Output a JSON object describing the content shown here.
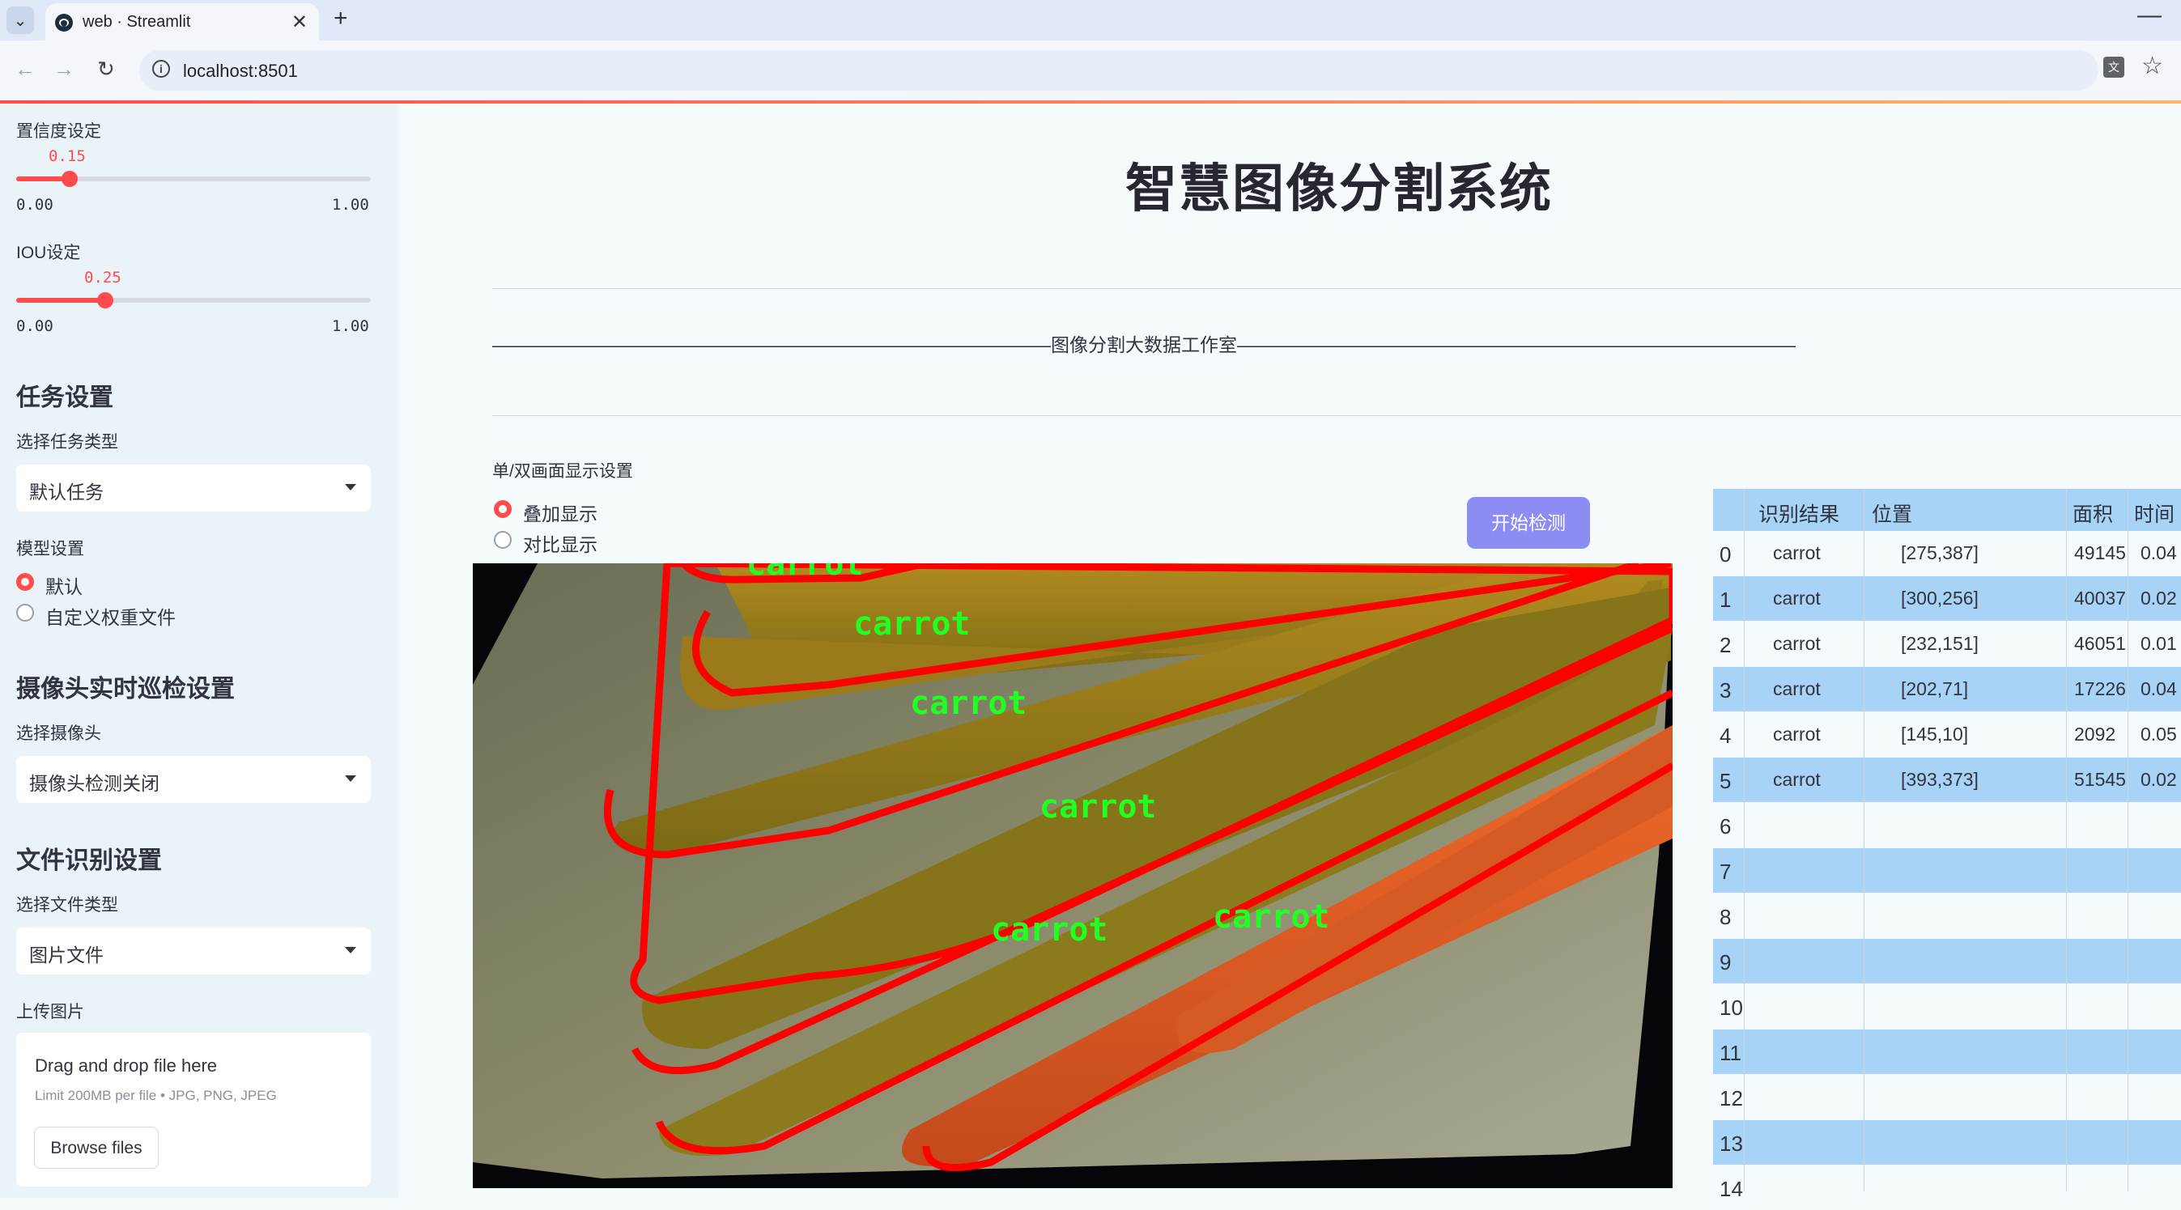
{
  "browser": {
    "tab_title": "web · Streamlit",
    "url": "localhost:8501"
  },
  "sidebar": {
    "confidence": {
      "label": "置信度设定",
      "value": "0.15",
      "value_fraction": 0.15,
      "min": "0.00",
      "max": "1.00"
    },
    "iou": {
      "label": "IOU设定",
      "value": "0.25",
      "value_fraction": 0.25,
      "min": "0.00",
      "max": "1.00"
    },
    "task_heading": "任务设置",
    "task_type_label": "选择任务类型",
    "task_type_value": "默认任务",
    "model_label": "模型设置",
    "model_options": [
      "默认",
      "自定义权重文件"
    ],
    "model_selected": 0,
    "camera_heading": "摄像头实时巡检设置",
    "camera_label": "选择摄像头",
    "camera_value": "摄像头检测关闭",
    "file_heading": "文件识别设置",
    "file_type_label": "选择文件类型",
    "file_type_value": "图片文件",
    "upload_label": "上传图片",
    "upload_drag": "Drag and drop file here",
    "upload_limit": "Limit 200MB per file • JPG, PNG, JPEG",
    "upload_button": "Browse files"
  },
  "main": {
    "title": "智慧图像分割系统",
    "divider_text": "——————————————————————————————图像分割大数据工作室——————————————————————————————",
    "display_label": "单/双画面显示设置",
    "display_options": [
      "叠加显示",
      "对比显示"
    ],
    "display_selected": 0,
    "start_button": "开始检测",
    "detection_labels": [
      "carrot",
      "carrot",
      "carrot",
      "carrot",
      "carrot",
      "carrot"
    ]
  },
  "table": {
    "headers": [
      "识别结果",
      "位置",
      "面积",
      "时间"
    ],
    "rows": [
      {
        "index": "0",
        "label": "carrot",
        "pos": "[275,387]",
        "area": "49145",
        "time": "0.04"
      },
      {
        "index": "1",
        "label": "carrot",
        "pos": "[300,256]",
        "area": "40037",
        "time": "0.02"
      },
      {
        "index": "2",
        "label": "carrot",
        "pos": "[232,151]",
        "area": "46051",
        "time": "0.01"
      },
      {
        "index": "3",
        "label": "carrot",
        "pos": "[202,71]",
        "area": "17226",
        "time": "0.04"
      },
      {
        "index": "4",
        "label": "carrot",
        "pos": "[145,10]",
        "area": "2092",
        "time": "0.05"
      },
      {
        "index": "5",
        "label": "carrot",
        "pos": "[393,373]",
        "area": "51545",
        "time": "0.02"
      },
      {
        "index": "6",
        "label": "",
        "pos": "",
        "area": "",
        "time": ""
      },
      {
        "index": "7",
        "label": "",
        "pos": "",
        "area": "",
        "time": ""
      },
      {
        "index": "8",
        "label": "",
        "pos": "",
        "area": "",
        "time": ""
      },
      {
        "index": "9",
        "label": "",
        "pos": "",
        "area": "",
        "time": ""
      },
      {
        "index": "10",
        "label": "",
        "pos": "",
        "area": "",
        "time": ""
      },
      {
        "index": "11",
        "label": "",
        "pos": "",
        "area": "",
        "time": ""
      },
      {
        "index": "12",
        "label": "",
        "pos": "",
        "area": "",
        "time": ""
      },
      {
        "index": "13",
        "label": "",
        "pos": "",
        "area": "",
        "time": ""
      },
      {
        "index": "14",
        "label": "",
        "pos": "",
        "area": "",
        "time": ""
      }
    ]
  },
  "colors": {
    "accent": "#ff4b4b",
    "button": "#8c8cf2",
    "table_stripe": "#a7d4f6",
    "mask_outline": "#ff0000",
    "label_text": "#22ff22"
  }
}
